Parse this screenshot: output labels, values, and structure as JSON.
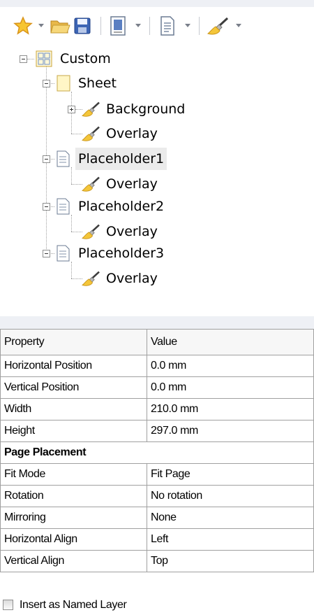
{
  "toolbar": {
    "buttons": [
      {
        "icon": "favorite-star-icon",
        "has_dropdown": true
      },
      {
        "icon": "open-folder-icon",
        "has_dropdown": false
      },
      {
        "icon": "save-floppy-icon",
        "has_dropdown": false
      },
      {
        "icon": "page-view-icon",
        "has_dropdown": true
      },
      {
        "icon": "add-page-icon",
        "has_dropdown": true
      },
      {
        "icon": "brush-icon",
        "has_dropdown": true
      }
    ]
  },
  "tree": {
    "root": "Custom",
    "sheet": "Sheet",
    "background": "Background",
    "overlay1": "Overlay",
    "placeholder1": "Placeholder1",
    "overlay2": "Overlay",
    "placeholder2": "Placeholder2",
    "overlay3": "Overlay",
    "placeholder3": "Placeholder3",
    "overlay4": "Overlay",
    "selected": "Placeholder1"
  },
  "grid": {
    "header": {
      "property": "Property",
      "value": "Value"
    },
    "rows": [
      {
        "property": "Horizontal Position",
        "value": "0.0 mm"
      },
      {
        "property": "Vertical Position",
        "value": "0.0 mm"
      },
      {
        "property": "Width",
        "value": "210.0 mm"
      },
      {
        "property": "Height",
        "value": "297.0 mm"
      }
    ],
    "section": "Page Placement",
    "section_rows": [
      {
        "property": "Fit Mode",
        "value": "Fit Page"
      },
      {
        "property": "Rotation",
        "value": "No rotation"
      },
      {
        "property": "Mirroring",
        "value": "None"
      },
      {
        "property": "Horizontal Align",
        "value": "Left"
      },
      {
        "property": "Vertical Align",
        "value": "Top"
      }
    ]
  },
  "checkbox": {
    "label": "Insert as Named Layer",
    "checked": false
  },
  "colors": {
    "toolbar_band": "#eef0f5",
    "grid_line": "#a0a0a0",
    "selection": "#ebebeb"
  }
}
